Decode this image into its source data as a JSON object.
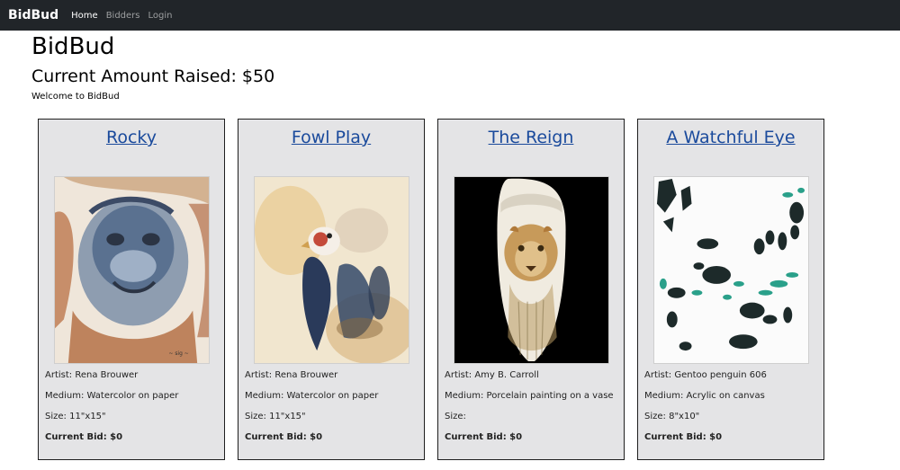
{
  "nav": {
    "brand": "BidBud",
    "links": [
      "Home",
      "Bidders",
      "Login"
    ]
  },
  "header": {
    "title": "BidBud",
    "raised_label": "Current Amount Raised:",
    "raised_amount": "$50",
    "welcome": "Welcome to BidBud"
  },
  "items": [
    {
      "title": "Rocky",
      "artist": "Artist: Rena Brouwer",
      "medium": "Medium: Watercolor on paper",
      "size": "Size: 11\"x15\"",
      "bid": "Current Bid: $0"
    },
    {
      "title": "Fowl Play",
      "artist": "Artist: Rena Brouwer",
      "medium": "Medium: Watercolor on paper",
      "size": "Size: 11\"x15\"",
      "bid": "Current Bid: $0"
    },
    {
      "title": "The Reign",
      "artist": "Artist: Amy B. Carroll",
      "medium": "Medium: Porcelain painting on a vase",
      "size": "Size:",
      "bid": "Current Bid: $0"
    },
    {
      "title": "A Watchful Eye",
      "artist": "Artist: Gentoo penguin 606",
      "medium": "Medium: Acrylic on canvas",
      "size": "Size: 8\"x10\"",
      "bid": "Current Bid: $0"
    }
  ],
  "colors": {
    "navbar": "#212529",
    "link": "#1a4a9c",
    "card_bg": "#e4e4e6"
  }
}
